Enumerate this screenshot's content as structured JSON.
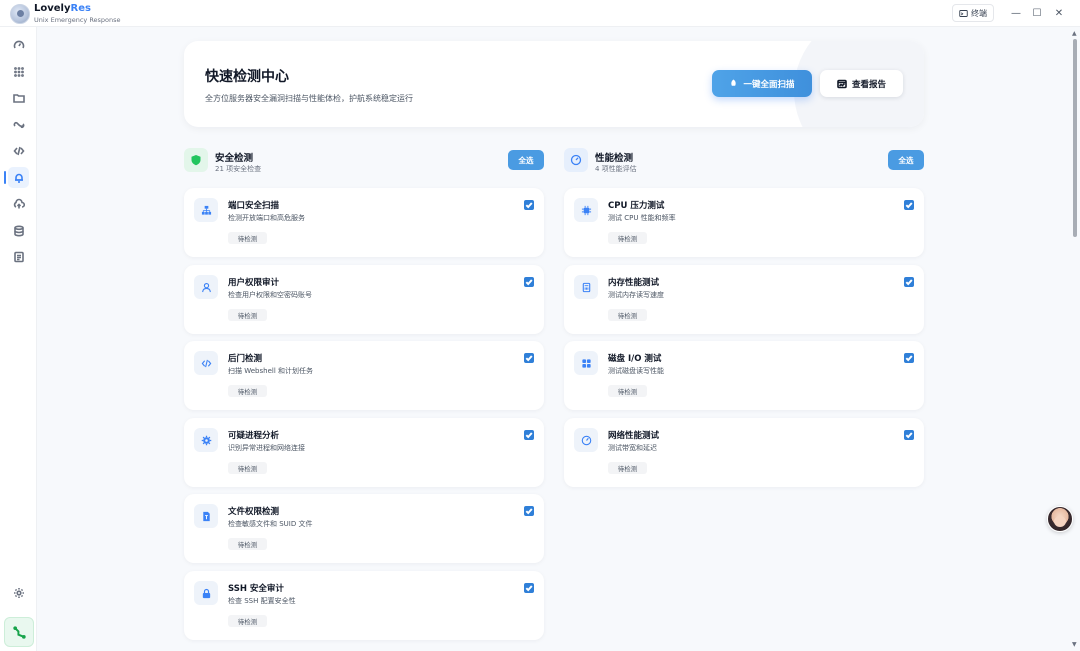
{
  "app": {
    "name_main": "Lovely",
    "name_accent": "Res",
    "subtitle": "Unix Emergency Response",
    "terminal_label": "终端"
  },
  "window_controls": [
    "—",
    "☐",
    "✕"
  ],
  "sidebar": {
    "items": [
      {
        "icon": "gauge-icon"
      },
      {
        "icon": "grid-icon"
      },
      {
        "icon": "folder-icon"
      },
      {
        "icon": "link-icon"
      },
      {
        "icon": "code-icon"
      },
      {
        "icon": "bell-icon",
        "active": true
      },
      {
        "icon": "cloud-upload-icon"
      },
      {
        "icon": "database-icon"
      },
      {
        "icon": "document-icon"
      }
    ],
    "settings_icon": "settings-icon",
    "bottom_icon": "route-icon"
  },
  "hero": {
    "title": "快速检测中心",
    "subtitle": "全方位服务器安全漏洞扫描与性能体检，护航系统稳定运行",
    "scan_button": "一键全面扫描",
    "report_button": "查看报告"
  },
  "security": {
    "title": "安全检测",
    "subtitle": "21 项安全检查",
    "select_all": "全选",
    "items": [
      {
        "title": "端口安全扫描",
        "desc": "检测开放端口和高危服务",
        "status": "待检测",
        "icon": "network-icon",
        "checked": true
      },
      {
        "title": "用户权限审计",
        "desc": "检查用户权限和空密码账号",
        "status": "待检测",
        "icon": "user-icon",
        "checked": true
      },
      {
        "title": "后门检测",
        "desc": "扫描 Webshell 和计划任务",
        "status": "待检测",
        "icon": "code-icon",
        "checked": true
      },
      {
        "title": "可疑进程分析",
        "desc": "识别异常进程和网络连接",
        "status": "待检测",
        "icon": "gear-icon",
        "checked": true
      },
      {
        "title": "文件权限检测",
        "desc": "检查敏感文件和 SUID 文件",
        "status": "待检测",
        "icon": "file-icon",
        "checked": true
      },
      {
        "title": "SSH 安全审计",
        "desc": "检查 SSH 配置安全性",
        "status": "待检测",
        "icon": "lock-icon",
        "checked": true
      }
    ]
  },
  "performance": {
    "title": "性能检测",
    "subtitle": "4 项性能评估",
    "select_all": "全选",
    "items": [
      {
        "title": "CPU 压力测试",
        "desc": "测试 CPU 性能和频率",
        "status": "待检测",
        "icon": "chip-icon",
        "checked": true
      },
      {
        "title": "内存性能测试",
        "desc": "测试内存读写速度",
        "status": "待检测",
        "icon": "memory-icon",
        "checked": true
      },
      {
        "title": "磁盘 I/O 测试",
        "desc": "测试磁盘读写性能",
        "status": "待检测",
        "icon": "disk-icon",
        "checked": true
      },
      {
        "title": "网络性能测试",
        "desc": "测试带宽和延迟",
        "status": "待检测",
        "icon": "compass-icon",
        "checked": true
      }
    ]
  },
  "colors": {
    "accent": "#3b82f6",
    "button_blue": "#4a9be2",
    "security_icon": "#22c55e",
    "performance_icon": "#3b82f6"
  }
}
